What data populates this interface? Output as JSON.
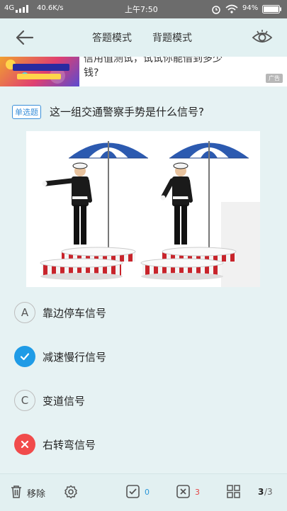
{
  "status_bar": {
    "network": "4G",
    "speed": "40.6K/s",
    "time": "上午7:50",
    "battery": "94%"
  },
  "header": {
    "tabs": [
      "答题模式",
      "背题模式"
    ]
  },
  "ad": {
    "text_line1": "信用值测试，试试你能借到多少",
    "text_line2": "钱?",
    "tag": "广告"
  },
  "question": {
    "type_label": "单选题",
    "text": "这一组交通警察手势是什么信号?",
    "options": [
      {
        "letter": "A",
        "text": "靠边停车信号",
        "state": "normal"
      },
      {
        "letter": "",
        "text": "减速慢行信号",
        "state": "correct"
      },
      {
        "letter": "C",
        "text": "变道信号",
        "state": "normal"
      },
      {
        "letter": "",
        "text": "右转弯信号",
        "state": "wrong"
      }
    ]
  },
  "bottom_bar": {
    "remove_label": "移除",
    "correct_count": "0",
    "wrong_count": "3",
    "progress": "3",
    "total": "/3"
  },
  "colors": {
    "accent": "#1f9be6",
    "wrong": "#f14b4b",
    "correct_count": "#2a96d8",
    "wrong_count": "#e54545"
  }
}
